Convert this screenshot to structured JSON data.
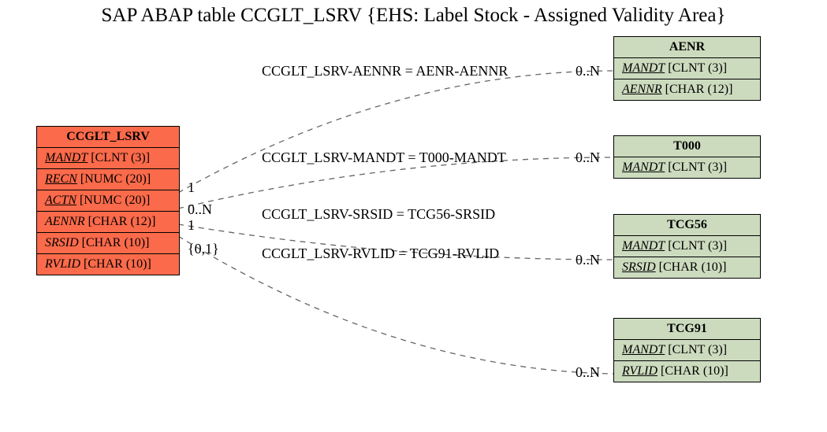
{
  "title": "SAP ABAP table CCGLT_LSRV {EHS: Label Stock - Assigned Validity Area}",
  "main": {
    "name": "CCGLT_LSRV",
    "fields": [
      {
        "key": "MANDT",
        "type": "[CLNT (3)]",
        "isKey": true
      },
      {
        "key": "RECN",
        "type": "[NUMC (20)]",
        "isKey": true
      },
      {
        "key": "ACTN",
        "type": "[NUMC (20)]",
        "isKey": true
      },
      {
        "key": "AENNR",
        "type": "[CHAR (12)]",
        "isKey": false
      },
      {
        "key": "SRSID",
        "type": "[CHAR (10)]",
        "isKey": false
      },
      {
        "key": "RVLID",
        "type": "[CHAR (10)]",
        "isKey": false
      }
    ]
  },
  "related": {
    "aenr": {
      "name": "AENR",
      "fields": [
        {
          "key": "MANDT",
          "type": "[CLNT (3)]",
          "isKey": true
        },
        {
          "key": "AENNR",
          "type": "[CHAR (12)]",
          "isKey": true
        }
      ]
    },
    "t000": {
      "name": "T000",
      "fields": [
        {
          "key": "MANDT",
          "type": "[CLNT (3)]",
          "isKey": true
        }
      ]
    },
    "tcg56": {
      "name": "TCG56",
      "fields": [
        {
          "key": "MANDT",
          "type": "[CLNT (3)]",
          "isKey": true
        },
        {
          "key": "SRSID",
          "type": "[CHAR (10)]",
          "isKey": true
        }
      ]
    },
    "tcg91": {
      "name": "TCG91",
      "fields": [
        {
          "key": "MANDT",
          "type": "[CLNT (3)]",
          "isKey": true
        },
        {
          "key": "RVLID",
          "type": "[CHAR (10)]",
          "isKey": true
        }
      ]
    }
  },
  "relations": {
    "r1": {
      "label": "CCGLT_LSRV-AENNR = AENR-AENNR",
      "leftCard": "1",
      "rightCard": "0..N"
    },
    "r2": {
      "label": "CCGLT_LSRV-MANDT = T000-MANDT",
      "leftCard": "0..N",
      "rightCard": "0..N"
    },
    "r3": {
      "label": "CCGLT_LSRV-SRSID = TCG56-SRSID",
      "leftCard": "1",
      "rightCard": "0..N"
    },
    "r4": {
      "label": "CCGLT_LSRV-RVLID = TCG91-RVLID",
      "leftCard": "{0,1}",
      "rightCard": "0..N"
    }
  },
  "chart_data": {
    "type": "table",
    "title": "SAP ABAP table CCGLT_LSRV {EHS: Label Stock - Assigned Validity Area}",
    "entities": [
      {
        "name": "CCGLT_LSRV",
        "role": "main",
        "columns": [
          {
            "name": "MANDT",
            "type": "CLNT",
            "length": 3,
            "key": true
          },
          {
            "name": "RECN",
            "type": "NUMC",
            "length": 20,
            "key": true
          },
          {
            "name": "ACTN",
            "type": "NUMC",
            "length": 20,
            "key": true
          },
          {
            "name": "AENNR",
            "type": "CHAR",
            "length": 12,
            "key": false
          },
          {
            "name": "SRSID",
            "type": "CHAR",
            "length": 10,
            "key": false
          },
          {
            "name": "RVLID",
            "type": "CHAR",
            "length": 10,
            "key": false
          }
        ]
      },
      {
        "name": "AENR",
        "role": "related",
        "columns": [
          {
            "name": "MANDT",
            "type": "CLNT",
            "length": 3,
            "key": true
          },
          {
            "name": "AENNR",
            "type": "CHAR",
            "length": 12,
            "key": true
          }
        ]
      },
      {
        "name": "T000",
        "role": "related",
        "columns": [
          {
            "name": "MANDT",
            "type": "CLNT",
            "length": 3,
            "key": true
          }
        ]
      },
      {
        "name": "TCG56",
        "role": "related",
        "columns": [
          {
            "name": "MANDT",
            "type": "CLNT",
            "length": 3,
            "key": true
          },
          {
            "name": "SRSID",
            "type": "CHAR",
            "length": 10,
            "key": true
          }
        ]
      },
      {
        "name": "TCG91",
        "role": "related",
        "columns": [
          {
            "name": "MANDT",
            "type": "CLNT",
            "length": 3,
            "key": true
          },
          {
            "name": "RVLID",
            "type": "CHAR",
            "length": 10,
            "key": true
          }
        ]
      }
    ],
    "relations": [
      {
        "from": "CCGLT_LSRV.AENNR",
        "to": "AENR.AENNR",
        "from_card": "1",
        "to_card": "0..N"
      },
      {
        "from": "CCGLT_LSRV.MANDT",
        "to": "T000.MANDT",
        "from_card": "0..N",
        "to_card": "0..N"
      },
      {
        "from": "CCGLT_LSRV.SRSID",
        "to": "TCG56.SRSID",
        "from_card": "1",
        "to_card": "0..N"
      },
      {
        "from": "CCGLT_LSRV.RVLID",
        "to": "TCG91.RVLID",
        "from_card": "{0,1}",
        "to_card": "0..N"
      }
    ]
  }
}
